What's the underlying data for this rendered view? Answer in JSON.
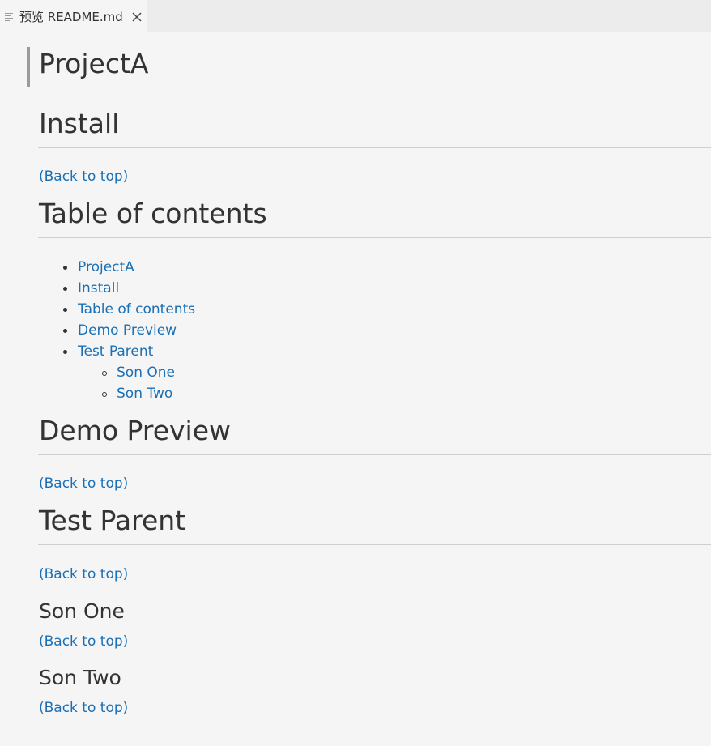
{
  "tab": {
    "title": "预览 README.md",
    "icon": "preview-lines-icon",
    "close_icon": "close-icon"
  },
  "doc": {
    "h_projecta": "ProjectA",
    "h_install": "Install",
    "back_to_top_1": "(Back to top)",
    "h_toc": "Table of contents",
    "toc": {
      "items": [
        "ProjectA",
        "Install",
        "Table of contents",
        "Demo Preview",
        "Test Parent"
      ],
      "subitems": [
        "Son One",
        "Son Two"
      ]
    },
    "h_demo": "Demo Preview",
    "back_to_top_2": "(Back to top)",
    "h_test_parent": "Test Parent",
    "back_to_top_3": "(Back to top)",
    "h_son_one": "Son One",
    "back_to_top_4": "(Back to top)",
    "h_son_two": "Son Two",
    "back_to_top_5": "(Back to top)"
  },
  "colors": {
    "link": "#1a6fb5",
    "text": "#333333",
    "background": "#f5f5f5"
  }
}
